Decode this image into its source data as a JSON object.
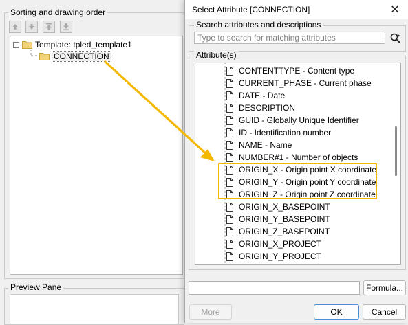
{
  "left_panel": {
    "sorting_label": "Sorting and drawing order",
    "toolbar_icons": [
      "move-up-icon",
      "move-down-icon",
      "move-top-icon",
      "move-bottom-icon"
    ],
    "tree": {
      "root_label": "Template: tpled_template1",
      "child_label": "CONNECTION"
    },
    "preview_label": "Preview Pane"
  },
  "dialog": {
    "title": "Select Attribute [CONNECTION]",
    "close_glyph": "✕",
    "search_section_label": "Search attributes and descriptions",
    "search_placeholder": "Type to search for matching attributes",
    "attributes_section_label": "Attribute(s)",
    "attributes": [
      "CONTENTTYPE  -  Content type",
      "CURRENT_PHASE  -  Current phase",
      "DATE  -  Date",
      "DESCRIPTION",
      "GUID  -  Globally Unique Identifier",
      "ID  -  Identification number",
      "NAME  -  Name",
      "NUMBER#1  -  Number of objects",
      "ORIGIN_X  -  Origin point X coordinate",
      "ORIGIN_Y  -  Origin point Y coordinate",
      "ORIGIN_Z  -  Origin point Z coordinate",
      "ORIGIN_X_BASEPOINT",
      "ORIGIN_Y_BASEPOINT",
      "ORIGIN_Z_BASEPOINT",
      "ORIGIN_X_PROJECT",
      "ORIGIN_Y_PROJECT"
    ],
    "formula_label": "Formula...",
    "more_label": "More",
    "ok_label": "OK",
    "cancel_label": "Cancel"
  },
  "annotation": {
    "color": "#f5b800",
    "highlighted_items": [
      "ORIGIN_X",
      "ORIGIN_Y",
      "ORIGIN_Z"
    ]
  },
  "colors": {
    "folder": "#f2d378",
    "accent": "#4a8fd6"
  }
}
